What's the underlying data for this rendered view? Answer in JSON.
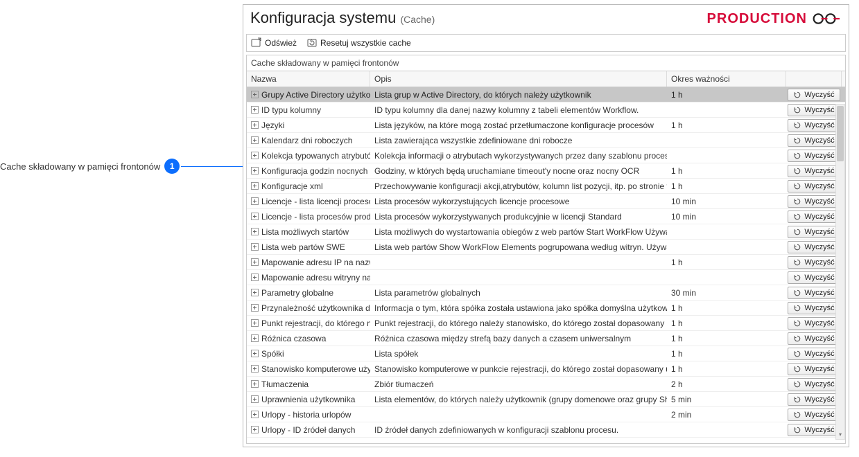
{
  "callout": {
    "label": "Cache składowany w pamięci frontonów",
    "badge": "1"
  },
  "window": {
    "title": "Konfiguracja systemu",
    "title_suffix": "(Cache)",
    "env_tag": "PRODUCTION"
  },
  "toolbar": {
    "refresh": "Odśwież",
    "reset_all": "Resetuj wszystkie cache"
  },
  "section_header": "Cache składowany w pamięci frontonów",
  "columns": {
    "name": "Nazwa",
    "desc": "Opis",
    "validity": "Okres ważności",
    "action": ""
  },
  "clear_label": "Wyczyść",
  "rows": [
    {
      "name": "Grupy Active Directory użytko..",
      "desc": "Lista grup w Active Directory, do których należy użytkownik",
      "validity": "1 h",
      "selected": true
    },
    {
      "name": "ID typu kolumny",
      "desc": "ID typu kolumny dla danej nazwy kolumny z tabeli elementów Workflow.",
      "validity": ""
    },
    {
      "name": "Języki",
      "desc": "Lista języków, na które mogą zostać przetłumaczone konfiguracje procesów",
      "validity": "1 h"
    },
    {
      "name": "Kalendarz dni roboczych",
      "desc": "Lista zawierająca wszystkie zdefiniowane dni robocze",
      "validity": ""
    },
    {
      "name": "Kolekcja typowanych atrybutów",
      "desc": "Kolekcja informacji o atrybutach wykorzystywanych przez dany szablonu procesu.",
      "validity": ""
    },
    {
      "name": "Konfiguracja godzin nocnych",
      "desc": "Godziny, w których będą uruchamiane timeout'y nocne oraz nocny OCR",
      "validity": "1 h"
    },
    {
      "name": "Konfiguracje xml",
      "desc": "Przechowywanie konfiguracji akcji,atrybutów, kolumn list pozycji, itp. po stronie for..",
      "validity": "1 h"
    },
    {
      "name": "Licencje - lista licencji proceso..",
      "desc": "Lista procesów wykorzystujących licencje procesowe",
      "validity": "10 min"
    },
    {
      "name": "Licencje - lista procesów produ..",
      "desc": "Lista procesów wykorzystywanych produkcyjnie w licencji Standard",
      "validity": "10 min"
    },
    {
      "name": "Lista możliwych startów",
      "desc": "Lista możliwych do wystartowania obiegów z web partów Start WorkFlow Używana ..",
      "validity": ""
    },
    {
      "name": "Lista web partów SWE",
      "desc": "Lista web partów Show WorkFlow Elements pogrupowana według witryn. Używana ..",
      "validity": ""
    },
    {
      "name": "Mapowanie adresu IP na nazw..",
      "desc": "",
      "validity": "1 h"
    },
    {
      "name": "Mapowanie adresu witryny na ..",
      "desc": "",
      "validity": ""
    },
    {
      "name": "Parametry globalne",
      "desc": "Lista parametrów globalnych",
      "validity": "30 min"
    },
    {
      "name": "Przynależność użytkownika do ..",
      "desc": "Informacja o tym, która spółka została ustawiona jako spółka domyślna użytkownika..",
      "validity": "1 h"
    },
    {
      "name": "Punkt rejestracji, do którego n..",
      "desc": "Punkt rejestracji, do którego należy stanowisko, do którego został dopasowany użyt..",
      "validity": "1 h"
    },
    {
      "name": "Różnica czasowa",
      "desc": "Różnica czasowa między strefą bazy danych a czasem uniwersalnym",
      "validity": "1 h"
    },
    {
      "name": "Spółki",
      "desc": "Lista spółek",
      "validity": "1 h"
    },
    {
      "name": "Stanowisko komputerowe użyt..",
      "desc": "Stanowisko komputerowe w punkcie rejestracji, do którego został dopasowany uż..",
      "validity": "1 h"
    },
    {
      "name": "Tłumaczenia",
      "desc": "Zbiór tłumaczeń",
      "validity": "2 h"
    },
    {
      "name": "Uprawnienia użytkownika",
      "desc": "Lista elementów, do których należy użytkownik (grupy domenowe oraz grupy Share..",
      "validity": "5 min"
    },
    {
      "name": "Urlopy - historia urlopów",
      "desc": "",
      "validity": "2 min"
    },
    {
      "name": "Urlopy - ID źródeł danych",
      "desc": "ID źródeł danych zdefiniowanych w konfiguracji szablonu procesu.",
      "validity": ""
    }
  ]
}
